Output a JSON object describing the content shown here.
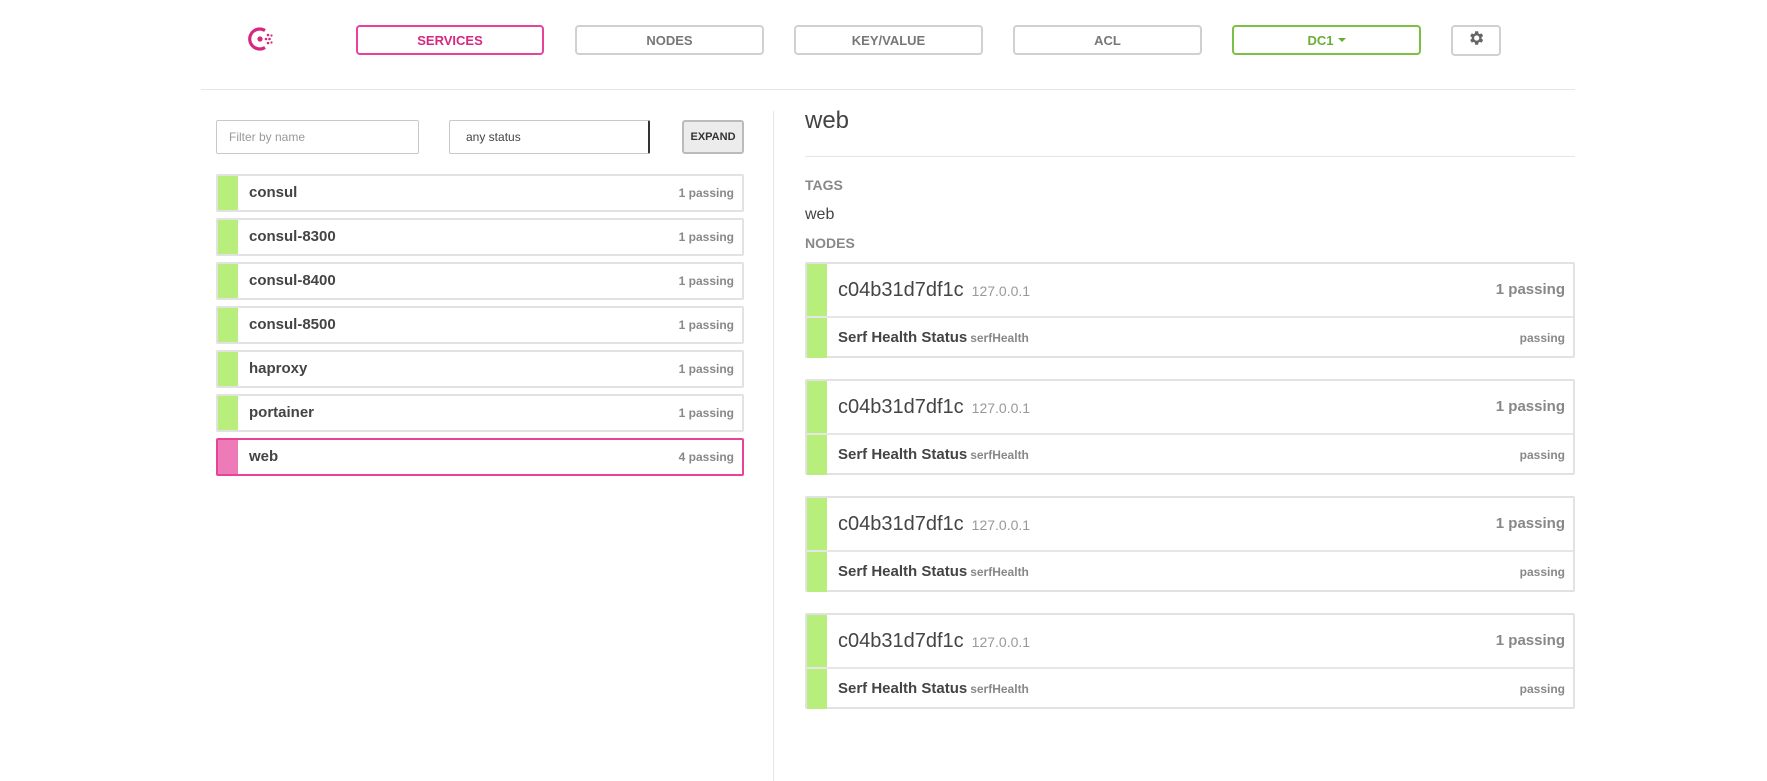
{
  "colors": {
    "accent": "#e9429a",
    "passing": "#b7ee7c",
    "active_bar": "#ec7bb7",
    "dc": "#7ac043"
  },
  "nav": {
    "logo_icon": "consul-logo-icon",
    "services": "SERVICES",
    "nodes": "NODES",
    "key_value": "KEY/VALUE",
    "acl": "ACL",
    "datacenter": "DC1",
    "settings_icon": "gear-icon"
  },
  "filter": {
    "placeholder": "Filter by name",
    "status": "any status",
    "expand": "EXPAND"
  },
  "services": [
    {
      "name": "consul",
      "count": "1 passing"
    },
    {
      "name": "consul-8300",
      "count": "1 passing"
    },
    {
      "name": "consul-8400",
      "count": "1 passing"
    },
    {
      "name": "consul-8500",
      "count": "1 passing"
    },
    {
      "name": "haproxy",
      "count": "1 passing"
    },
    {
      "name": "portainer",
      "count": "1 passing"
    },
    {
      "name": "web",
      "count": "4 passing"
    }
  ],
  "detail": {
    "title": "web",
    "tags_label": "TAGS",
    "tag": "web",
    "nodes_label": "NODES",
    "nodes": [
      {
        "name": "c04b31d7df1c",
        "address": "127.0.0.1",
        "count": "1 passing",
        "check": "Serf Health Status",
        "check_id": "serfHealth",
        "status": "passing"
      },
      {
        "name": "c04b31d7df1c",
        "address": "127.0.0.1",
        "count": "1 passing",
        "check": "Serf Health Status",
        "check_id": "serfHealth",
        "status": "passing"
      },
      {
        "name": "c04b31d7df1c",
        "address": "127.0.0.1",
        "count": "1 passing",
        "check": "Serf Health Status",
        "check_id": "serfHealth",
        "status": "passing"
      },
      {
        "name": "c04b31d7df1c",
        "address": "127.0.0.1",
        "count": "1 passing",
        "check": "Serf Health Status",
        "check_id": "serfHealth",
        "status": "passing"
      }
    ]
  }
}
